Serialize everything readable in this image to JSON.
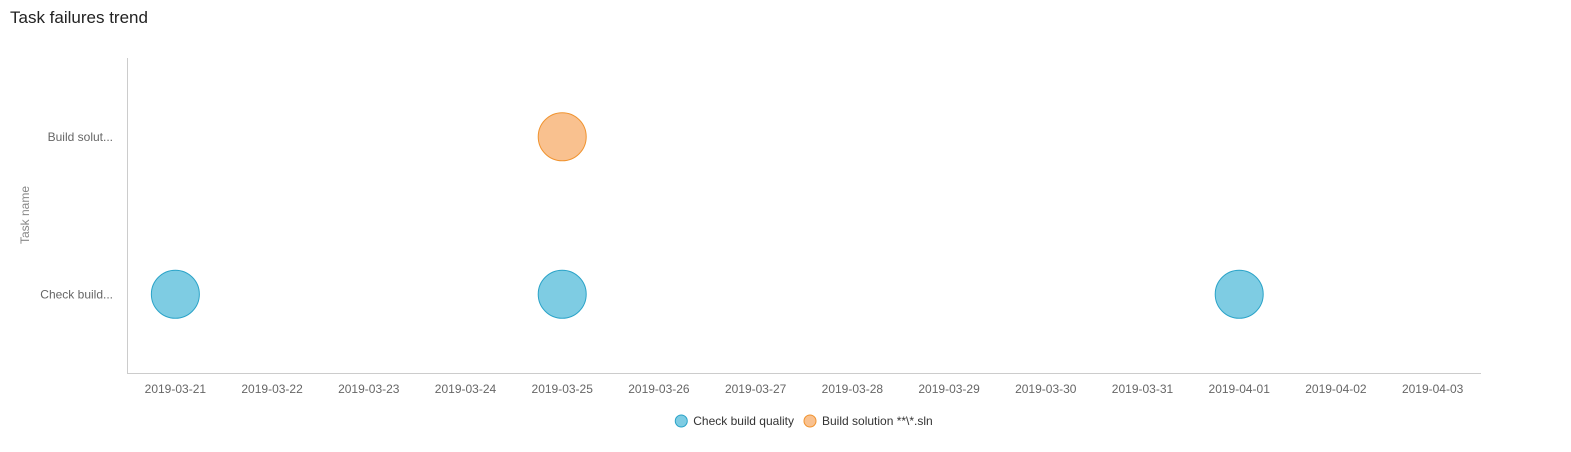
{
  "panel": {
    "title": "Task failures trend"
  },
  "chart_data": {
    "type": "scatter",
    "title": "Task failures trend",
    "xlabel": "",
    "ylabel": "Task name",
    "categories_x": [
      "2019-03-21",
      "2019-03-22",
      "2019-03-23",
      "2019-03-24",
      "2019-03-25",
      "2019-03-26",
      "2019-03-27",
      "2019-03-28",
      "2019-03-29",
      "2019-03-30",
      "2019-03-31",
      "2019-04-01",
      "2019-04-02",
      "2019-04-03"
    ],
    "categories_y": [
      "Check build...",
      "Build solut..."
    ],
    "grid": false,
    "legend_position": "bottom",
    "series": [
      {
        "name": "Check build quality",
        "color": "#7ecce3",
        "stroke": "#2aa3c8",
        "points": [
          {
            "x": "2019-03-21",
            "y": "Check build..."
          },
          {
            "x": "2019-03-25",
            "y": "Check build..."
          },
          {
            "x": "2019-04-01",
            "y": "Check build..."
          }
        ]
      },
      {
        "name": "Build solution **\\*.sln",
        "color": "#f9c18f",
        "stroke": "#f0932f",
        "points": [
          {
            "x": "2019-03-25",
            "y": "Build solut..."
          }
        ]
      }
    ]
  }
}
